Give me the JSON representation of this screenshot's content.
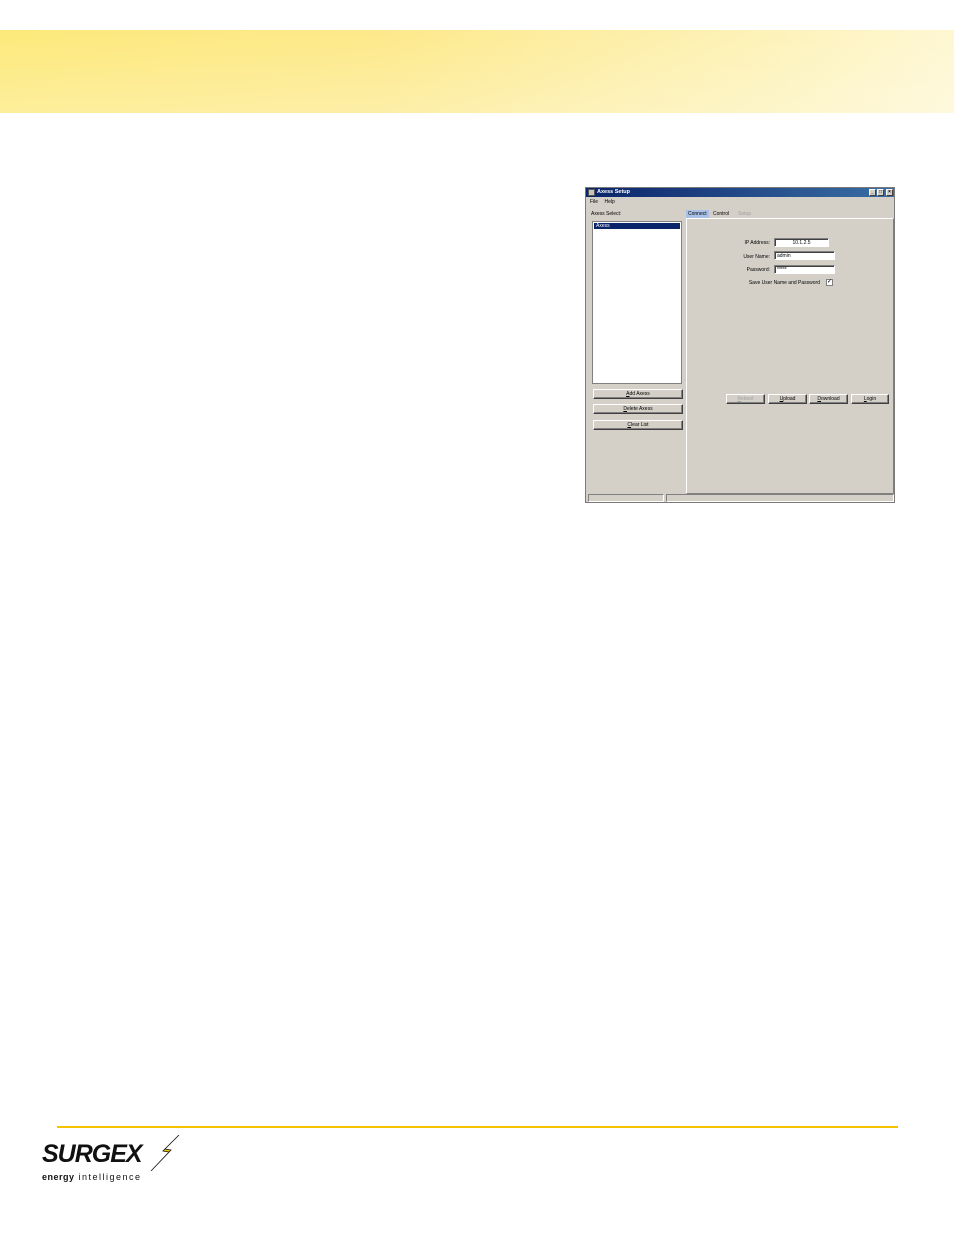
{
  "window": {
    "title": "Axess Setup",
    "controls": {
      "minimize": "_",
      "maximize": "□",
      "close": "×"
    }
  },
  "menu": {
    "file": "File",
    "help": "Help"
  },
  "sidebar": {
    "label": "Axess Select:",
    "items": [
      "Axess"
    ],
    "buttons": {
      "add": "Add Axess",
      "delete": "Delete Axess",
      "clear": "Clear List"
    }
  },
  "tabs": {
    "connect": "Connect",
    "control": "Control",
    "setup": "Setup"
  },
  "connect": {
    "ip_label": "IP Address:",
    "ip_value": "10.1.2.5",
    "user_label": "User Name:",
    "user_value": "admin",
    "password_label": "Password:",
    "password_value": "*****",
    "save_label": "Save User Name and Password",
    "save_checked": "✓"
  },
  "actions": {
    "reboot": "Reboot",
    "upload": "Upload",
    "download": "Download",
    "login": "Login"
  },
  "logo": {
    "name": "SURGEX",
    "tagline_bold": "energy",
    "tagline_rest": " intelligence"
  },
  "colors": {
    "band": "#fde97a",
    "rule": "#f5c400",
    "titlebar": "#0a246a"
  }
}
